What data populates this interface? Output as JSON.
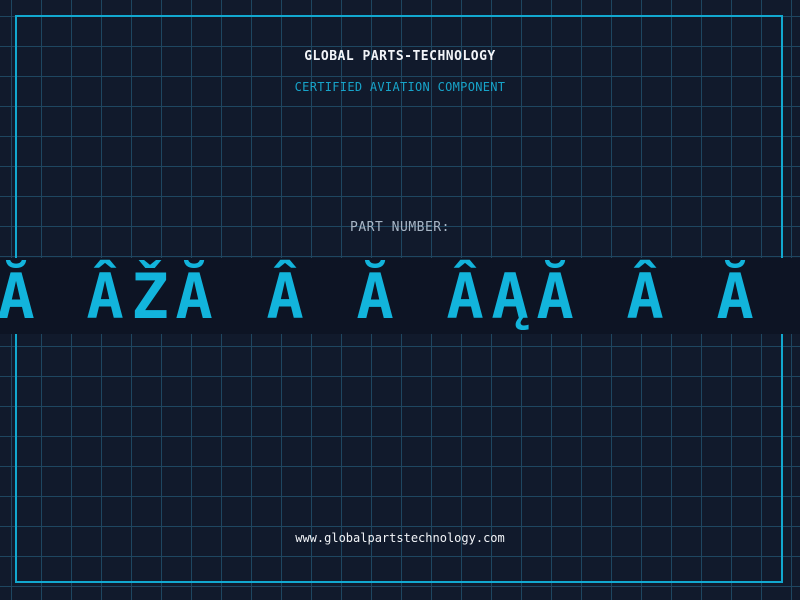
{
  "company_name": "GLOBAL PARTS-TECHNOLOGY",
  "subtitle": "CERTIFIED AVIATION COMPONENT",
  "part_number_label": "PART NUMBER:",
  "part_number_glyphs": [
    "Ă",
    "Â",
    "Ž",
    "Ă",
    "Â",
    "Ă",
    "Â",
    "Ą",
    "Ă",
    "Â",
    "Ă"
  ],
  "website": "www.globalpartstechnology.com",
  "colors": {
    "background": "#111a2c",
    "grid": "#1e4660",
    "frame": "#12a8cf",
    "accent": "#12b4dc",
    "text": "#f2f4f8"
  }
}
